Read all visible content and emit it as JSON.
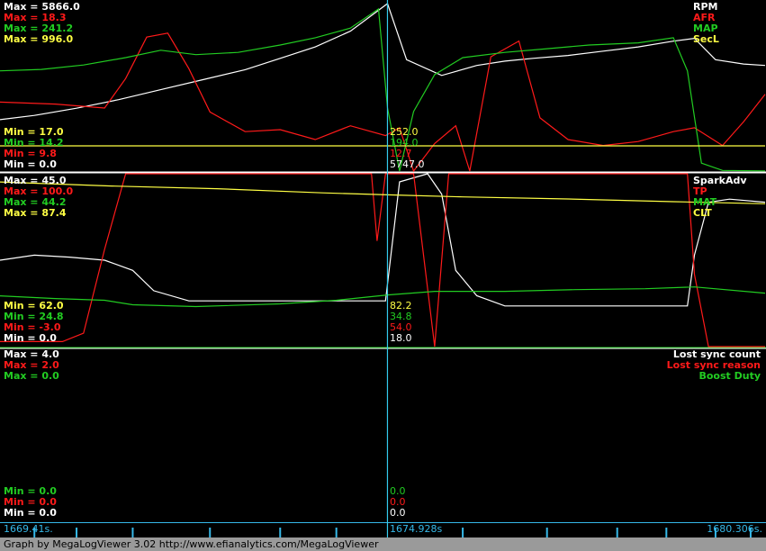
{
  "colors": {
    "white": "#ffffff",
    "red": "#ff1a1a",
    "green": "#22cc22",
    "yellow": "#ffff44",
    "cursor": "#33ccee",
    "time": "#36b8e8"
  },
  "panel1": {
    "max_labels": [
      "Max = 5866.0",
      "Max = 18.3",
      "Max = 241.2",
      "Max = 996.0"
    ],
    "min_labels": [
      "Min = 17.0",
      "Min = 14.2",
      "Min = 9.8",
      "Min = 0.0"
    ],
    "legend": [
      "RPM",
      "AFR",
      "MAP",
      "SecL"
    ],
    "cursor_values": [
      "252.0",
      "194.0",
      "12.7",
      "5747.0"
    ]
  },
  "panel2": {
    "max_labels": [
      "Max = 45.0",
      "Max = 100.0",
      "Max = 44.2",
      "Max = 87.4"
    ],
    "min_labels": [
      "Min = 62.0",
      "Min = 24.8",
      "Min = -3.0",
      "Min = 0.0"
    ],
    "legend": [
      "SparkAdv",
      "TP",
      "MAT",
      "CLT"
    ],
    "cursor_values": [
      "82.2",
      "34.8",
      "54.0",
      "18.0"
    ]
  },
  "panel3": {
    "max_labels": [
      "Max = 4.0",
      "Max = 2.0",
      "Max = 0.0"
    ],
    "min_labels": [
      "Min = 0.0",
      "Min = 0.0",
      "Min = 0.0"
    ],
    "legend": [
      "Lost sync count",
      "Lost sync reason",
      "Boost Duty"
    ],
    "cursor_values": [
      "0.0",
      "0.0",
      "0.0"
    ]
  },
  "time_axis": {
    "left": "1669.41s.",
    "cursor": "1674.928s",
    "right": "1680.306s."
  },
  "footer": "Graph by MegaLogViewer 3.02 http://www.efianalytics.com/MegaLogViewer",
  "chart_data": [
    {
      "type": "line",
      "title": "",
      "x_range": [
        1669.41,
        1680.306
      ],
      "cursor_x": 1674.928,
      "series": [
        {
          "name": "RPM",
          "color": "#ffffff",
          "range": [
            0,
            5866
          ],
          "x": [
            1669.41,
            1669.9,
            1670.5,
            1671.1,
            1671.7,
            1672.3,
            1672.9,
            1673.4,
            1673.9,
            1674.4,
            1674.928,
            1675.2,
            1675.7,
            1676.2,
            1676.6,
            1677.0,
            1677.5,
            1678.0,
            1678.5,
            1679.0,
            1679.3,
            1679.6,
            1680.0,
            1680.306
          ],
          "values": [
            1800,
            1950,
            2200,
            2500,
            2850,
            3200,
            3550,
            3950,
            4350,
            4900,
            5866,
            3900,
            3350,
            3700,
            3850,
            3950,
            4050,
            4200,
            4350,
            4550,
            4650,
            3900,
            3750,
            3700
          ]
        },
        {
          "name": "AFR",
          "color": "#ff1a1a",
          "range": [
            9.8,
            18.3
          ],
          "x": [
            1669.41,
            1670.2,
            1670.9,
            1671.2,
            1671.5,
            1671.8,
            1672.1,
            1672.4,
            1672.9,
            1673.4,
            1673.9,
            1674.4,
            1674.9,
            1675.1,
            1675.3,
            1675.6,
            1675.9,
            1676.1,
            1676.4,
            1676.8,
            1677.1,
            1677.5,
            1678.0,
            1678.5,
            1679.0,
            1679.3,
            1679.7,
            1680.0,
            1680.306
          ],
          "values": [
            13.3,
            13.2,
            13.0,
            14.5,
            16.6,
            16.8,
            15.0,
            12.8,
            11.8,
            11.9,
            11.4,
            12.1,
            11.6,
            12.0,
            9.8,
            11.2,
            12.1,
            9.8,
            15.6,
            16.4,
            12.5,
            11.4,
            11.1,
            11.3,
            11.8,
            12.0,
            11.1,
            12.3,
            13.7
          ]
        },
        {
          "name": "MAP",
          "color": "#22cc22",
          "range": [
            14.2,
            241.2
          ],
          "x": [
            1669.41,
            1670.0,
            1670.6,
            1671.2,
            1671.7,
            1672.2,
            1672.8,
            1673.4,
            1673.9,
            1674.4,
            1674.8,
            1674.928,
            1675.1,
            1675.3,
            1675.6,
            1676.0,
            1676.6,
            1677.2,
            1677.8,
            1678.5,
            1679.0,
            1679.2,
            1679.4,
            1679.7,
            1680.306
          ],
          "values": [
            150,
            152,
            158,
            168,
            178,
            172,
            175,
            185,
            195,
            208,
            234,
            100,
            14.2,
            95,
            145,
            168,
            175,
            180,
            185,
            188,
            195,
            150,
            25,
            15,
            14.5
          ]
        },
        {
          "name": "SecL",
          "color": "#ffff44",
          "range": [
            0,
            996
          ],
          "x": [
            1669.41,
            1680.306
          ],
          "values": [
            150,
            150
          ]
        },
        {
          "name": "SparkAdv",
          "color": "#ffffff",
          "range": [
            62,
            45
          ],
          "x": [
            1669.41,
            1669.9,
            1670.4,
            1670.9,
            1671.3,
            1671.6,
            1672.1,
            1672.8,
            1673.6,
            1674.3,
            1674.9,
            1675.1,
            1675.5,
            1675.7,
            1675.9,
            1676.2,
            1676.6,
            1677.3,
            1678.0,
            1678.8,
            1679.2,
            1679.3,
            1679.5,
            1679.8,
            1680.306
          ],
          "values": [
            53.5,
            53.0,
            53.2,
            53.5,
            54.5,
            56.5,
            57.5,
            57.5,
            57.5,
            57.5,
            57.5,
            45.8,
            45.0,
            47.0,
            54.5,
            57.0,
            58.0,
            58.0,
            58.0,
            58.0,
            58.0,
            53.0,
            47.8,
            47.5,
            47.8
          ]
        },
        {
          "name": "TP",
          "color": "#ff1a1a",
          "range": [
            -3,
            100
          ],
          "x": [
            1669.41,
            1670.3,
            1670.6,
            1670.9,
            1671.2,
            1674.7,
            1674.78,
            1674.9,
            1675.3,
            1675.6,
            1675.8,
            1679.2,
            1679.3,
            1679.5,
            1680.306
          ],
          "values": [
            0,
            0,
            5,
            55,
            100,
            100,
            60,
            100,
            100,
            -3,
            100,
            100,
            40,
            -3,
            -3
          ]
        },
        {
          "name": "MAT",
          "color": "#22cc22",
          "range": [
            24.8,
            44.2
          ],
          "x": [
            1669.41,
            1670.2,
            1670.9,
            1671.3,
            1672.2,
            1673.4,
            1674.2,
            1674.928,
            1675.6,
            1676.6,
            1677.6,
            1678.6,
            1679.3,
            1680.306
          ],
          "values": [
            30.5,
            30.2,
            30.0,
            29.5,
            29.3,
            29.6,
            30.0,
            30.6,
            31.0,
            31.0,
            31.2,
            31.3,
            31.5,
            30.8
          ]
        },
        {
          "name": "CLT",
          "color": "#ffff44",
          "range": [
            62,
            87.4
          ],
          "x": [
            1669.41,
            1671.0,
            1672.5,
            1674.0,
            1674.928,
            1676.0,
            1677.5,
            1679.0,
            1680.306
          ],
          "values": [
            86.2,
            85.6,
            85.2,
            84.6,
            84.3,
            84.0,
            83.7,
            83.3,
            83.0
          ]
        },
        {
          "name": "Lost sync count",
          "color": "#ffffff",
          "range": [
            0,
            4
          ],
          "x": [
            1669.41,
            1680.306
          ],
          "values": [
            0,
            0
          ]
        },
        {
          "name": "Lost sync reason",
          "color": "#ff1a1a",
          "range": [
            0,
            2
          ],
          "x": [
            1669.41,
            1680.306
          ],
          "values": [
            0,
            0
          ]
        },
        {
          "name": "Boost Duty",
          "color": "#22cc22",
          "range": [
            0,
            0
          ],
          "x": [
            1669.41,
            1680.306
          ],
          "values": [
            0,
            0
          ]
        }
      ]
    }
  ]
}
